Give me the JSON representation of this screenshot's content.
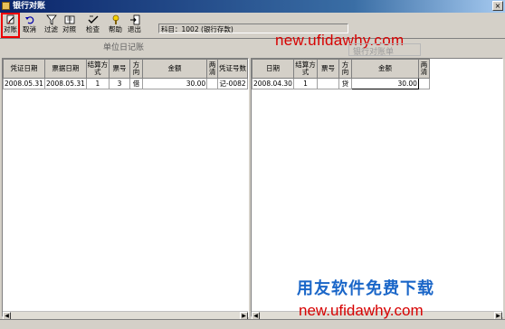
{
  "window": {
    "title": "银行对账",
    "close_glyph": "×"
  },
  "toolbar": {
    "buttons": [
      {
        "label": "对账",
        "icon": "reconcile-icon"
      },
      {
        "label": "取消",
        "icon": "undo-icon"
      },
      {
        "label": "过滤",
        "icon": "filter-icon"
      },
      {
        "label": "对照",
        "icon": "compare-icon"
      },
      {
        "label": "检查",
        "icon": "check-icon"
      },
      {
        "label": "帮助",
        "icon": "help-icon"
      },
      {
        "label": "退出",
        "icon": "exit-icon"
      }
    ]
  },
  "subject": "科目：1002 (银行存款)",
  "left_panel": {
    "caption": "单位日记账",
    "columns": [
      "凭证日期",
      "票据日期",
      "结算方式",
      "票号",
      "方向",
      "金额",
      "两清",
      "凭证号数"
    ],
    "rows": [
      {
        "voucher_date": "2008.05.31",
        "bill_date": "2008.05.31",
        "settle": "1",
        "ticket": "3",
        "direction": "借",
        "amount": "30.00",
        "cleared": "",
        "voucher_no": "记-0082"
      }
    ]
  },
  "right_panel": {
    "caption": "银行对账单",
    "columns": [
      "日期",
      "结算方式",
      "票号",
      "方向",
      "金额",
      "两清"
    ],
    "rows": [
      {
        "date": "2008.04.30",
        "settle": "1",
        "ticket": "",
        "direction": "贷",
        "amount": "30.00",
        "cleared": ""
      }
    ]
  },
  "watermarks": {
    "url_top": "new.ufidawhy.com",
    "cn_text": "用友软件免费下载",
    "url_bottom": "new.ufidawhy.com"
  },
  "colors": {
    "title_bar": "#0a246a",
    "window_bg": "#d4d0c8",
    "watermark_red": "#d70000",
    "watermark_blue": "#1a66c8"
  }
}
